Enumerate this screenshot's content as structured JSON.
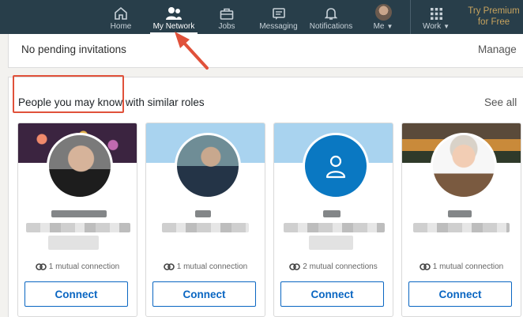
{
  "nav": {
    "items": [
      {
        "label": "Home",
        "icon": "home-icon"
      },
      {
        "label": "My Network",
        "icon": "network-icon",
        "active": true
      },
      {
        "label": "Jobs",
        "icon": "briefcase-icon"
      },
      {
        "label": "Messaging",
        "icon": "messaging-icon"
      },
      {
        "label": "Notifications",
        "icon": "bell-icon"
      },
      {
        "label": "Me",
        "icon": "avatar"
      },
      {
        "label": "Work",
        "icon": "grid-icon"
      }
    ],
    "premium_line1": "Try Premium",
    "premium_line2": "for Free"
  },
  "invitations": {
    "text": "No pending invitations",
    "manage_label": "Manage"
  },
  "pymk": {
    "title": "People you may know with similar roles",
    "see_all_label": "See all",
    "cards": [
      {
        "mutual": "1 mutual connection",
        "connect_label": "Connect"
      },
      {
        "mutual": "1 mutual connection",
        "connect_label": "Connect"
      },
      {
        "mutual": "2 mutual connections",
        "connect_label": "Connect"
      },
      {
        "mutual": "1 mutual connection",
        "connect_label": "Connect"
      }
    ]
  },
  "colors": {
    "nav_bg": "#283e4a",
    "accent": "#0a66c2",
    "annotation": "#e0513a",
    "premium": "#c7a35e"
  }
}
